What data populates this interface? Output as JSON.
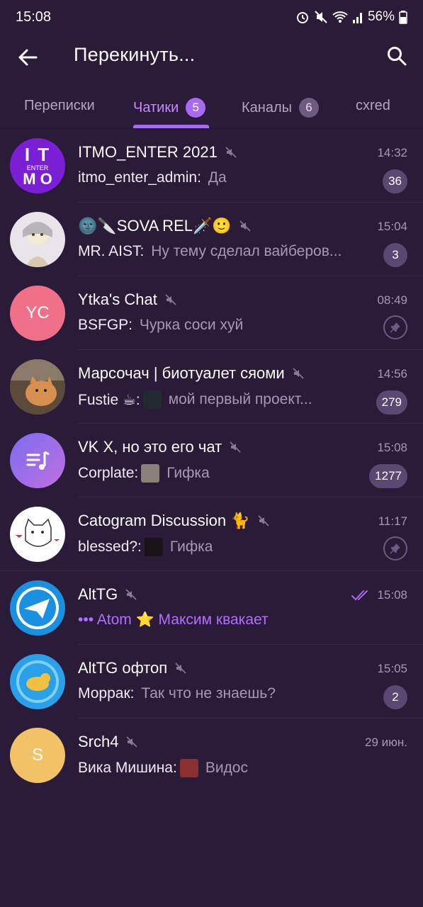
{
  "status_bar": {
    "time": "15:08",
    "battery": "56%"
  },
  "appbar": {
    "title": "Перекинуть..."
  },
  "tabs": [
    {
      "label": "Переписки",
      "count": ""
    },
    {
      "label": "Чатики",
      "count": "5"
    },
    {
      "label": "Каналы",
      "count": "6"
    },
    {
      "label": "cxred",
      "count": ""
    }
  ],
  "chats": [
    {
      "name": "ITMO_ENTER 2021",
      "time": "14:32",
      "sender": "itmo_enter_admin:",
      "text": "Да",
      "badge": "36",
      "avatar_text": "ENTER"
    },
    {
      "name": "🌚🔪SOVA REL🗡️🙂",
      "time": "15:04",
      "sender": "MR. AIST:",
      "text": "Ну тему сделал вайберов...",
      "badge": "3"
    },
    {
      "name": "Ytka's Chat",
      "time": "08:49",
      "sender": "BSFGP:",
      "text": "Чурка соси хуй",
      "avatar_text": "YC"
    },
    {
      "name": "Марсочач | биотуалет сяоми",
      "time": "14:56",
      "sender": "Fustie ☕:",
      "text": "мой первый проект...",
      "badge": "279"
    },
    {
      "name": "VK X, но это его чат",
      "time": "15:08",
      "sender": "Corplate:",
      "text": "Гифка",
      "badge": "1277"
    },
    {
      "name": "Catogram Discussion 🐈",
      "time": "11:17",
      "sender": "blessed?:",
      "text": "Гифка"
    },
    {
      "name": "AltTG",
      "time": "15:08",
      "typing": "••• Atom ⭐ Максим квакает"
    },
    {
      "name": "AltTG офтоп",
      "time": "15:05",
      "sender": "Моррак:",
      "text": "Так что не знаешь?",
      "badge": "2"
    },
    {
      "name": "Srch4",
      "time": "29 июн.",
      "sender": "Вика Мишина:",
      "text": "Видос",
      "avatar_text": "S"
    }
  ],
  "colors": {
    "background": "#2a1b38",
    "accent": "#a86af0",
    "badge": "#5b4872"
  }
}
